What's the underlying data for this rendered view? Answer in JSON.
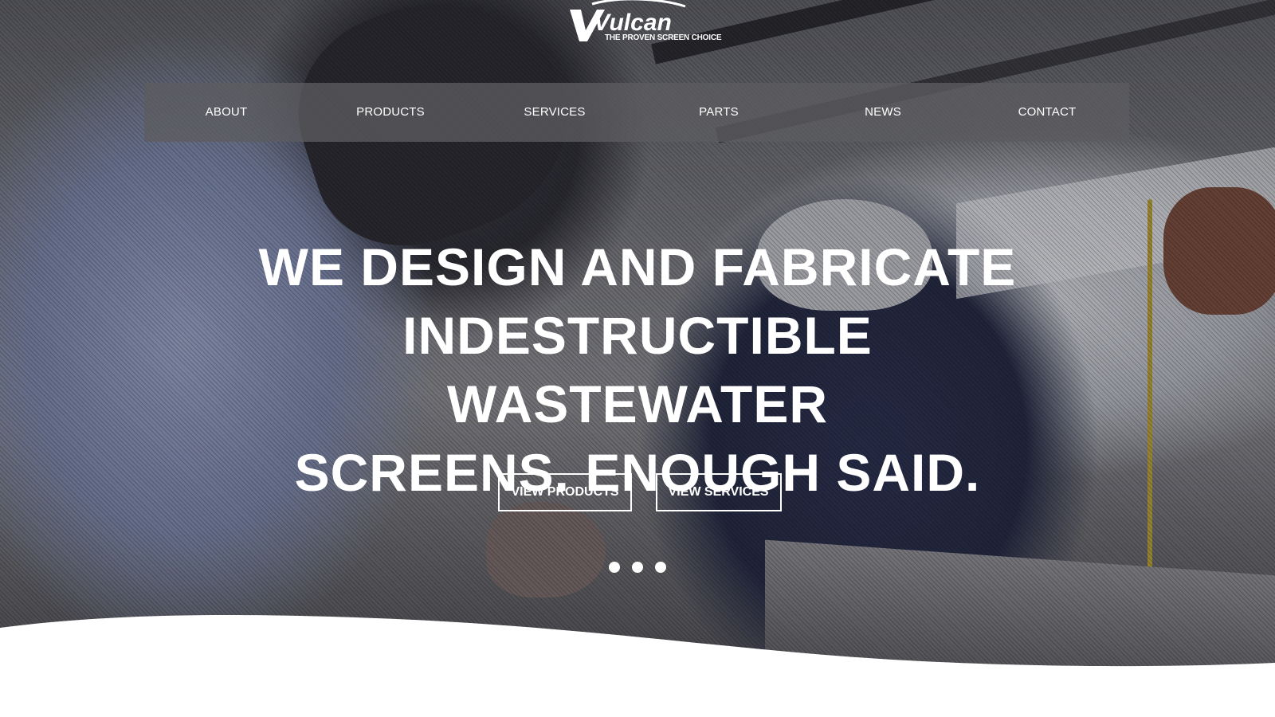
{
  "brand": {
    "name": "Vulcan",
    "tagline": "THE PROVEN SCREEN CHOICE"
  },
  "nav": {
    "items": [
      {
        "label": "ABOUT"
      },
      {
        "label": "PRODUCTS"
      },
      {
        "label": "SERVICES"
      },
      {
        "label": "PARTS"
      },
      {
        "label": "NEWS"
      },
      {
        "label": "CONTACT"
      }
    ]
  },
  "hero": {
    "headline_lines": [
      "WE DESIGN AND FABRICATE",
      "INDESTRUCTIBLE WASTEWATER",
      "SCREENS. ENOUGH SAID."
    ],
    "buttons": {
      "primary": "VIEW PRODUCTS",
      "secondary": "VIEW SERVICES"
    },
    "slider": {
      "slide_count": 3
    }
  },
  "colors": {
    "text": "#ffffff",
    "nav_background": "#5c5c60",
    "page_background": "#ffffff"
  }
}
